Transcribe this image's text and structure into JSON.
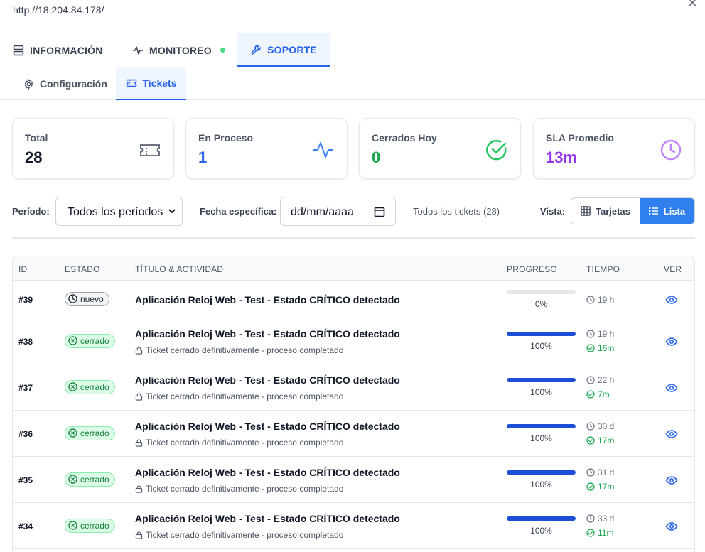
{
  "browser": {
    "url": "http://18.204.84.178/",
    "close": "✕"
  },
  "main_tabs": [
    {
      "label": "INFORMACIÓN",
      "icon": "server-icon"
    },
    {
      "label": "MONITOREO",
      "icon": "activity-icon",
      "status": "online"
    },
    {
      "label": "SOPORTE",
      "icon": "wrench-icon",
      "active": true
    }
  ],
  "sub_tabs": [
    {
      "label": "Configuración",
      "icon": "gear-icon"
    },
    {
      "label": "Tickets",
      "icon": "ticket-icon",
      "active": true
    }
  ],
  "stats": {
    "total": {
      "label": "Total",
      "value": "28",
      "color": "#111827"
    },
    "en_proceso": {
      "label": "En Proceso",
      "value": "1",
      "color": "#2563eb"
    },
    "cerrados_hoy": {
      "label": "Cerrados Hoy",
      "value": "0",
      "color": "#16a34a"
    },
    "sla": {
      "label": "SLA Promedio",
      "value": "13m",
      "color": "#9333ea"
    }
  },
  "filters": {
    "periodo_label": "Período:",
    "periodo_value": "Todos los períodos",
    "fecha_label": "Fecha específica:",
    "fecha_placeholder": "dd/mm/aaaa",
    "count_text": "Todos los tickets (28)",
    "vista_label": "Vista:",
    "vista_tarjetas": "Tarjetas",
    "vista_lista": "Lista"
  },
  "table": {
    "headers": {
      "id": "ID",
      "estado": "ESTADO",
      "titulo": "TÍTULO & ACTIVIDAD",
      "progreso": "PROGRESO",
      "tiempo": "TIEMPO",
      "ver": "VER"
    },
    "rows": [
      {
        "id": "#39",
        "estado": "nuevo",
        "title": "Aplicación Reloj Web - Test - Estado CRÍTICO detectado",
        "activity": "",
        "progress": 0,
        "progress_text": "0%",
        "time": "19 h",
        "sla": ""
      },
      {
        "id": "#38",
        "estado": "cerrado",
        "title": "Aplicación Reloj Web - Test - Estado CRÍTICO detectado",
        "activity": "Ticket cerrado definitivamente - proceso completado",
        "progress": 100,
        "progress_text": "100%",
        "time": "19 h",
        "sla": "16m"
      },
      {
        "id": "#37",
        "estado": "cerrado",
        "title": "Aplicación Reloj Web - Test - Estado CRÍTICO detectado",
        "activity": "Ticket cerrado definitivamente - proceso completado",
        "progress": 100,
        "progress_text": "100%",
        "time": "22 h",
        "sla": "7m"
      },
      {
        "id": "#36",
        "estado": "cerrado",
        "title": "Aplicación Reloj Web - Test - Estado CRÍTICO detectado",
        "activity": "Ticket cerrado definitivamente - proceso completado",
        "progress": 100,
        "progress_text": "100%",
        "time": "30 d",
        "sla": "17m"
      },
      {
        "id": "#35",
        "estado": "cerrado",
        "title": "Aplicación Reloj Web - Test - Estado CRÍTICO detectado",
        "activity": "Ticket cerrado definitivamente - proceso completado",
        "progress": 100,
        "progress_text": "100%",
        "time": "31 d",
        "sla": "17m"
      },
      {
        "id": "#34",
        "estado": "cerrado",
        "title": "Aplicación Reloj Web - Test - Estado CRÍTICO detectado",
        "activity": "Ticket cerrado definitivamente - proceso completado",
        "progress": 100,
        "progress_text": "100%",
        "time": "33 d",
        "sla": "11m"
      }
    ]
  }
}
